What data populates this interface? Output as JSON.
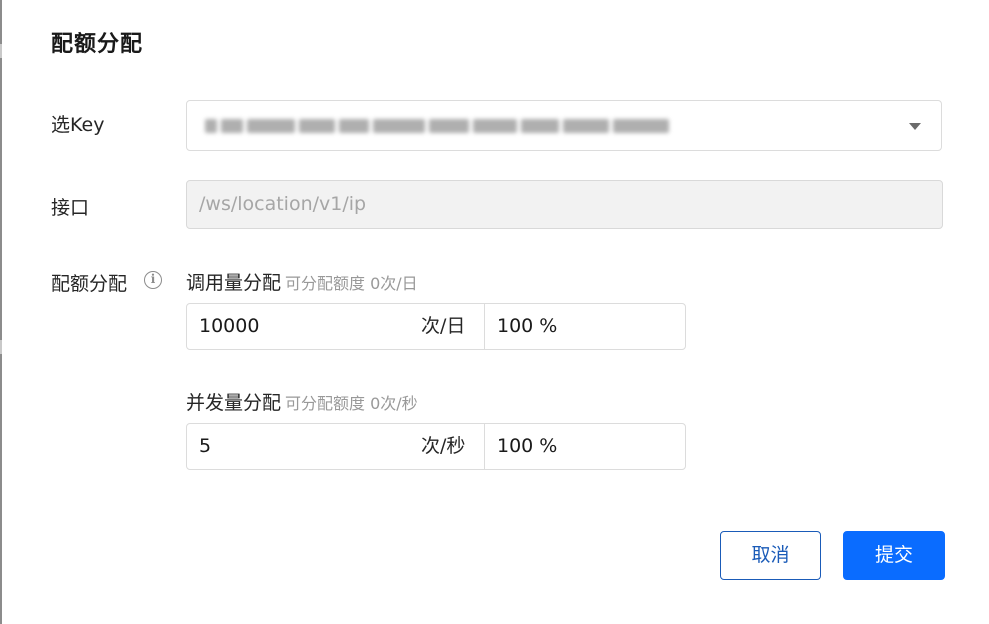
{
  "dialog": {
    "title": "配额分配"
  },
  "form": {
    "key_label": "选Key",
    "api_label": "接口",
    "api_value": "/ws/location/v1/ip",
    "quota_label": "配额分配",
    "info_icon": "info-circle-icon",
    "select_caret_icon": "caret-down-icon"
  },
  "call_quota": {
    "title": "调用量分配",
    "hint": "可分配额度 0次/日",
    "value": "10000",
    "unit": "次/日",
    "percent": "100 %"
  },
  "concurrency_quota": {
    "title": "并发量分配",
    "hint": "可分配额度 0次/秒",
    "value": "5",
    "unit": "次/秒",
    "percent": "100 %"
  },
  "actions": {
    "cancel_label": "取消",
    "submit_label": "提交"
  },
  "colors": {
    "primary": "#0a6cff",
    "cancel_border": "#1a5bb8",
    "disabled_bg": "#f2f2f2",
    "hint_text": "#999999"
  }
}
